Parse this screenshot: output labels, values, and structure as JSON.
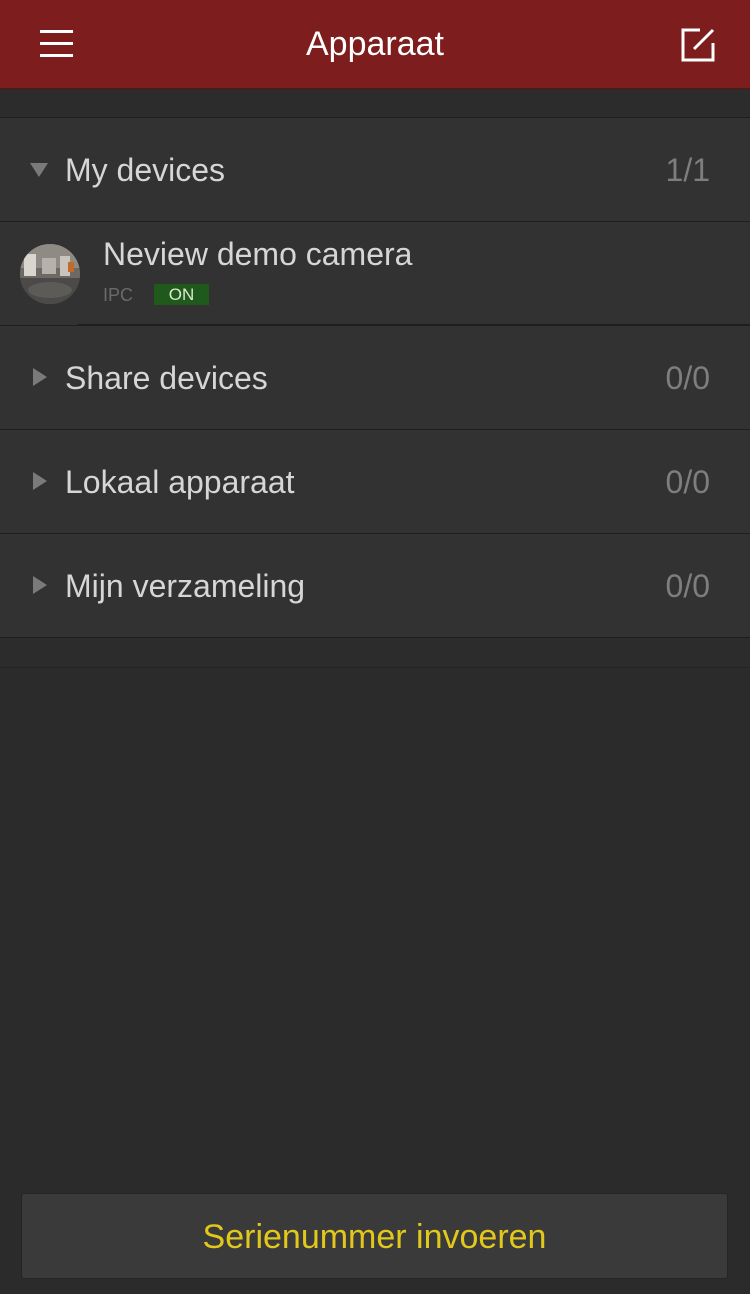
{
  "header": {
    "title": "Apparaat",
    "menu_icon": "hamburger-menu-icon",
    "edit_icon": "edit-square-icon",
    "background_color": "#7e1d1d"
  },
  "groups": [
    {
      "label": "My devices",
      "count": "1/1",
      "expanded": true
    },
    {
      "label": "Share devices",
      "count": "0/0",
      "expanded": false
    },
    {
      "label": "Lokaal apparaat",
      "count": "0/0",
      "expanded": false
    },
    {
      "label": "Mijn verzameling",
      "count": "0/0",
      "expanded": false
    }
  ],
  "devices": [
    {
      "name": "Neview demo camera",
      "type": "IPC",
      "status": "ON",
      "status_color": "#1f5a1c"
    }
  ],
  "footer": {
    "serial_button_label": "Serienummer invoeren",
    "serial_button_color": "#e3c81c"
  }
}
